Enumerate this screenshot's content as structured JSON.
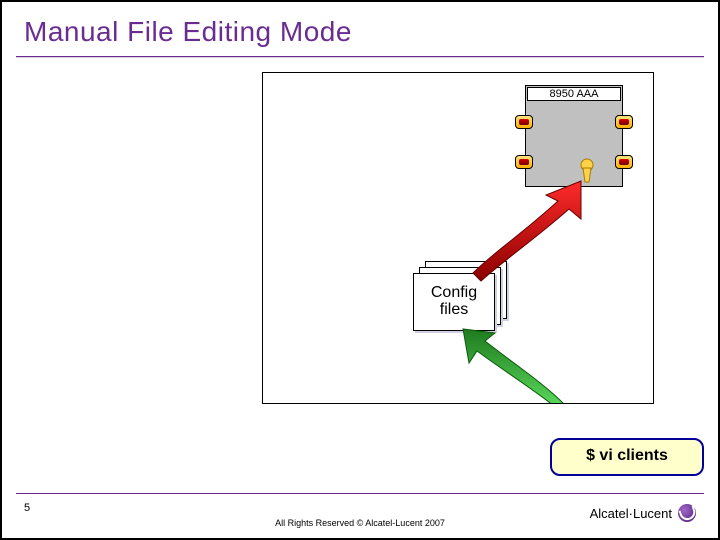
{
  "title": "Manual File Editing Mode",
  "diagram": {
    "server_label": "8950 AAA",
    "config_label_top": "Config",
    "config_label_bottom": "files"
  },
  "command": "$ vi clients",
  "footer": {
    "page": "5",
    "copyright": "All Rights Reserved © Alcatel-Lucent 2007",
    "brand": "Alcatel·Lucent"
  },
  "colors": {
    "purple": "#6a2c91",
    "cmd_bg": "#ffffcc",
    "cmd_border": "#000099",
    "arrow_red": "#d40000",
    "arrow_green": "#2faa2f"
  }
}
